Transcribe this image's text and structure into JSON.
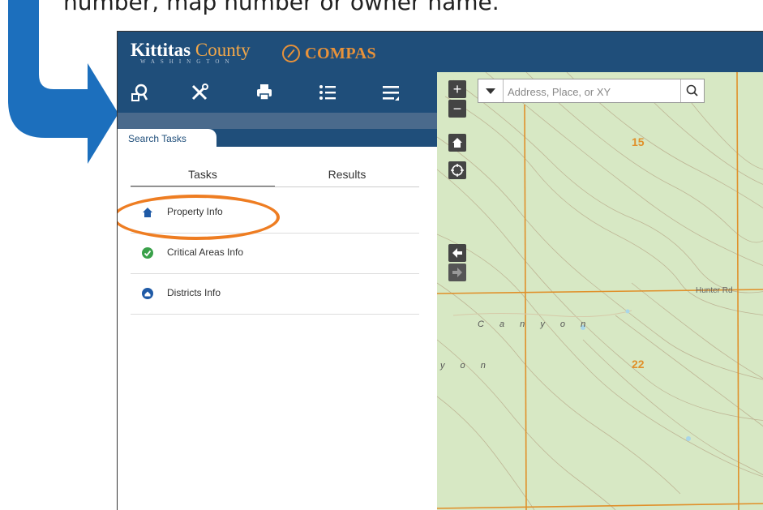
{
  "caption": "number, map number or owner name.",
  "colors": {
    "header": "#1f4e7a",
    "accent": "#e8923a",
    "highlight": "#ee7d22",
    "arrow": "#1c6fbd"
  },
  "logo": {
    "name": "Kittitas",
    "county": "County",
    "sub": "WASHINGTON",
    "app": "COMPAS"
  },
  "toolbar": {
    "icons": [
      "search-parcel-icon",
      "tools-icon",
      "print-icon",
      "layer-list-icon",
      "legend-icon"
    ]
  },
  "panel": {
    "tab_label": "Search Tasks",
    "subtabs": [
      "Tasks",
      "Results"
    ],
    "tasks": [
      {
        "label": "Property Info",
        "icon": "home-icon"
      },
      {
        "label": "Critical Areas Info",
        "icon": "check-circle-icon"
      },
      {
        "label": "Districts Info",
        "icon": "district-icon"
      }
    ]
  },
  "map": {
    "search_placeholder": "Address, Place, or XY",
    "zoom_in": "+",
    "zoom_out": "−",
    "labels": {
      "sec15": "15",
      "sec22": "22",
      "road": "Hunter Rd",
      "canyon1": "C a n y o n",
      "canyon2": "y o n"
    }
  }
}
